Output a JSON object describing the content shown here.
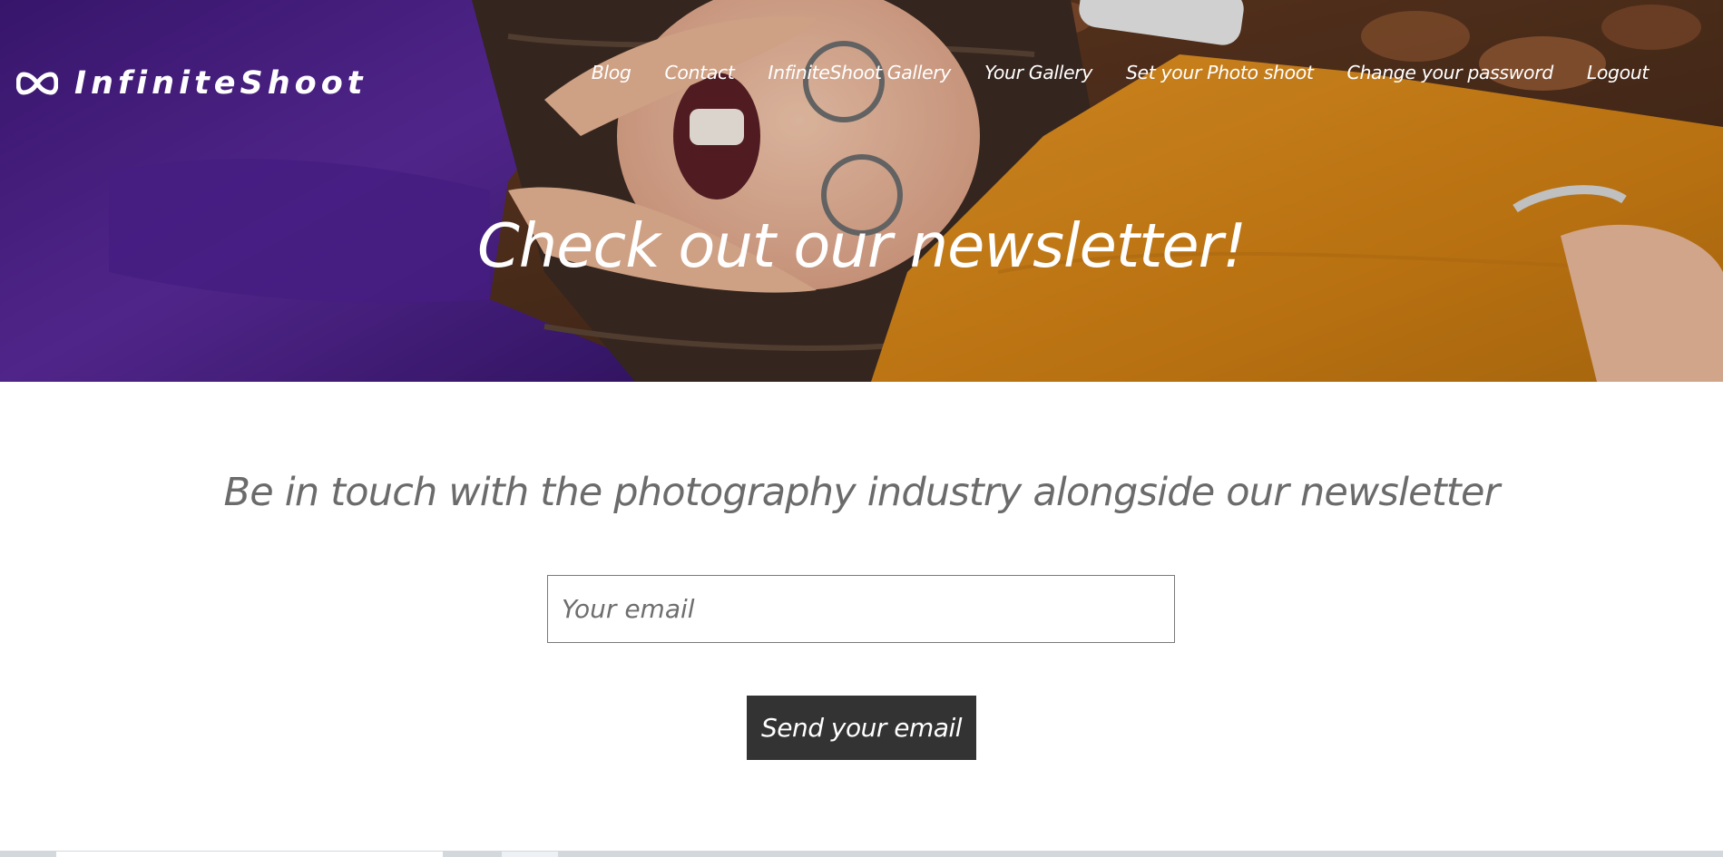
{
  "brand": {
    "name": "InfiniteShoot",
    "icon": "infinity-icon"
  },
  "nav": {
    "items": [
      {
        "label": "Blog"
      },
      {
        "label": "Contact"
      },
      {
        "label": "InfiniteShoot Gallery"
      },
      {
        "label": "Your Gallery"
      },
      {
        "label": "Set your Photo shoot"
      },
      {
        "label": "Change your password"
      },
      {
        "label": "Logout"
      }
    ]
  },
  "hero": {
    "title": "Check out our newsletter!"
  },
  "newsletter": {
    "subtitle": "Be in touch with the photography industry alongside our newsletter",
    "email_placeholder": "Your email",
    "email_value": "",
    "submit_label": "Send your email"
  },
  "colors": {
    "button_bg": "#333333",
    "subtitle_text": "#6b6b6b",
    "hero_purple": "#4b1f8a",
    "hero_orange": "#d98a1c"
  }
}
